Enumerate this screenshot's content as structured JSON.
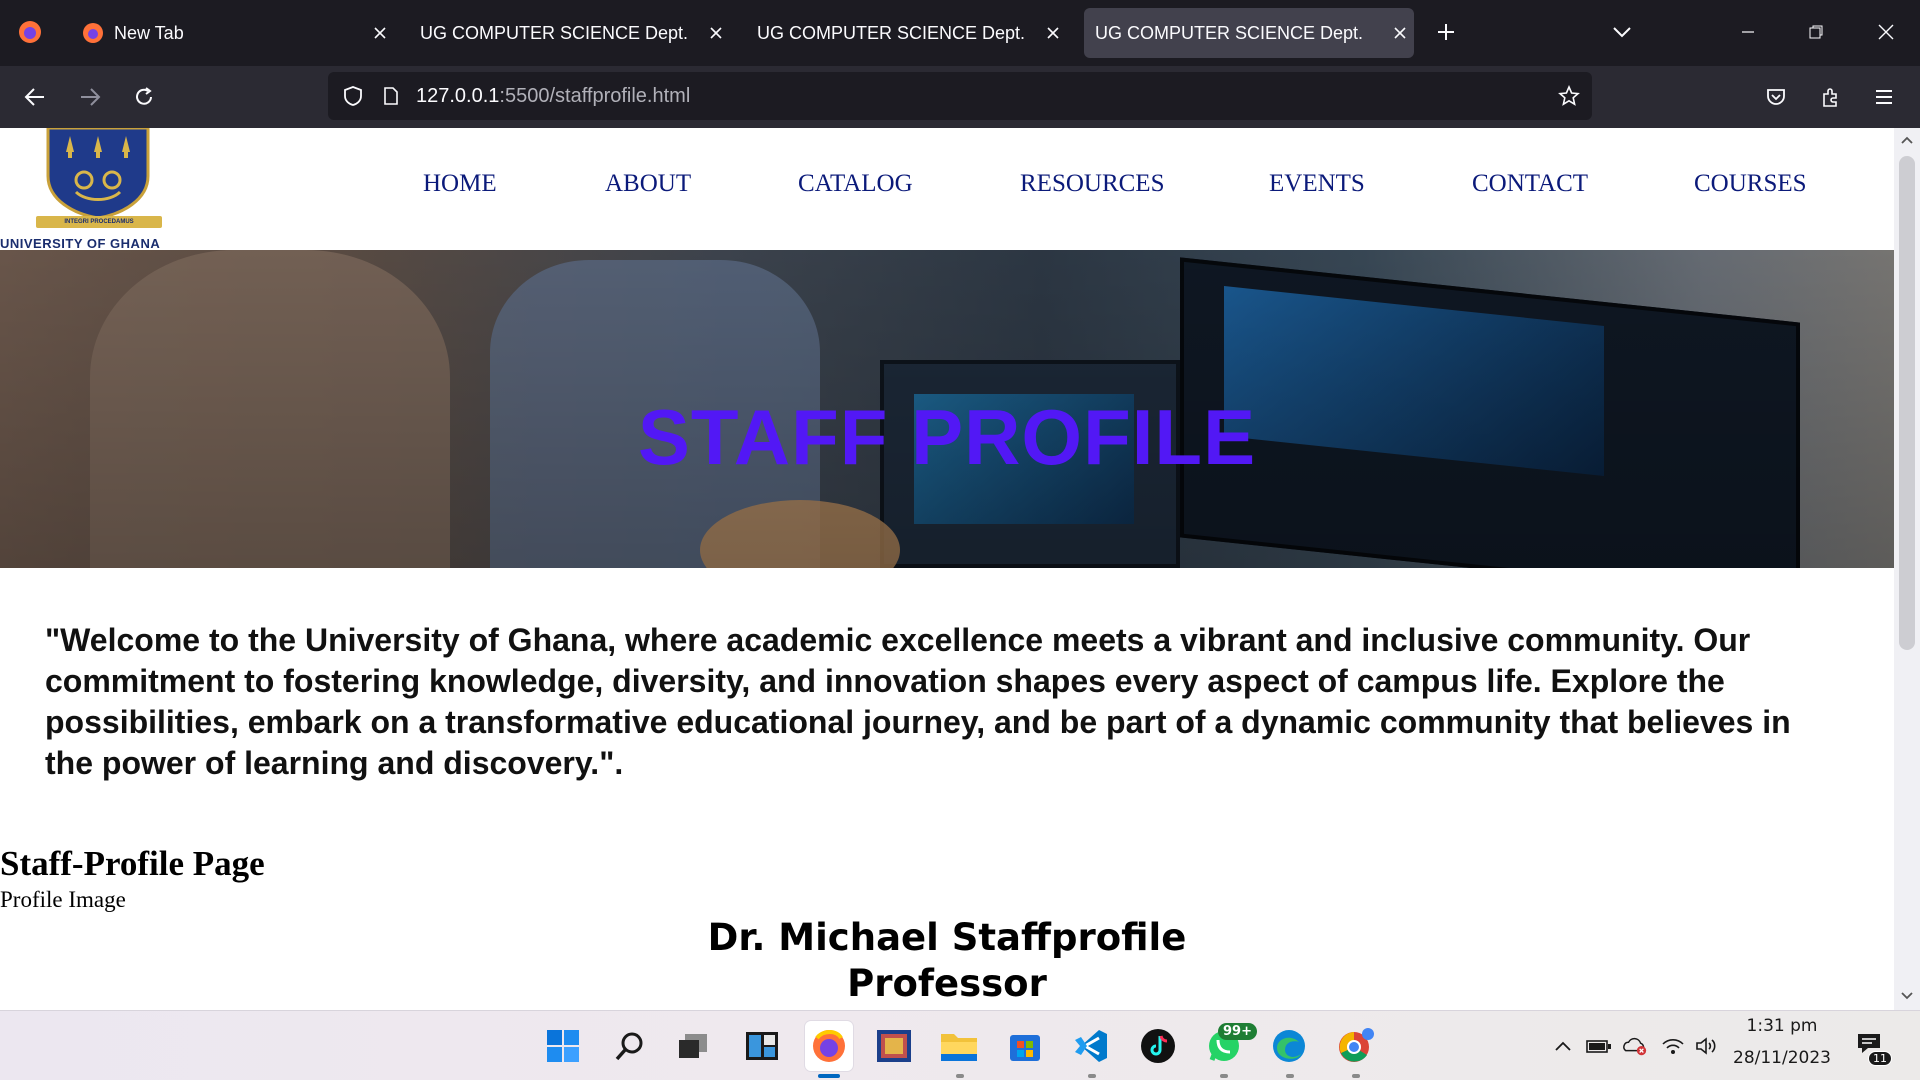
{
  "browser": {
    "tabs": [
      {
        "label": "New Tab",
        "active": false
      },
      {
        "label": "UG COMPUTER SCIENCE Dept.",
        "active": false
      },
      {
        "label": "UG COMPUTER SCIENCE Dept.",
        "active": false
      },
      {
        "label": "UG COMPUTER SCIENCE Dept.",
        "active": true
      }
    ],
    "url_host": "127.0.0.1",
    "url_path": ":5500/staffprofile.html"
  },
  "site": {
    "logo_name": "UNIVERSITY OF GHANA",
    "logo_motto": "INTEGRI PROCEDAMUS",
    "nav": [
      {
        "label": "HOME"
      },
      {
        "label": "ABOUT"
      },
      {
        "label": "CATALOG"
      },
      {
        "label": "RESOURCES"
      },
      {
        "label": "EVENTS"
      },
      {
        "label": "CONTACT"
      },
      {
        "label": "COURSES"
      }
    ],
    "hero_title": "STAFF PROFILE",
    "welcome": "\"Welcome to the University of Ghana, where academic excellence meets a vibrant and inclusive community. Our commitment to fostering knowledge, diversity, and innovation shapes every aspect of campus life. Explore the possibilities, embark on a transformative educational journey, and be part of a dynamic community that believes in the power of learning and discovery.\".",
    "staff_heading": "Staff-Profile Page",
    "profile_image_label": "Profile Image",
    "staff_name": "Dr. Michael Staffprofile",
    "staff_title": "Professor"
  },
  "taskbar": {
    "whatsapp_badge": "99+",
    "notification_count": "11",
    "time": "1:31 pm",
    "date": "28/11/2023"
  },
  "colors": {
    "nav_text": "#0b1a7a",
    "hero_title": "#5218f5",
    "browser_bg": "#1c1b22"
  },
  "icons": [
    "firefox-icon",
    "close-icon",
    "plus-icon",
    "chevron-down-icon",
    "minimize-icon",
    "restore-icon",
    "back-icon",
    "forward-icon",
    "reload-icon",
    "shield-icon",
    "page-icon",
    "star-icon",
    "pocket-icon",
    "extensions-icon",
    "menu-icon",
    "windows-start-icon",
    "search-icon",
    "task-view-icon",
    "widgets-icon",
    "photos-icon",
    "file-explorer-icon",
    "store-icon",
    "vscode-icon",
    "tiktok-icon",
    "whatsapp-icon",
    "edge-icon",
    "chrome-icon",
    "battery-icon",
    "onedrive-icon",
    "wifi-icon",
    "volume-icon",
    "notification-icon"
  ]
}
